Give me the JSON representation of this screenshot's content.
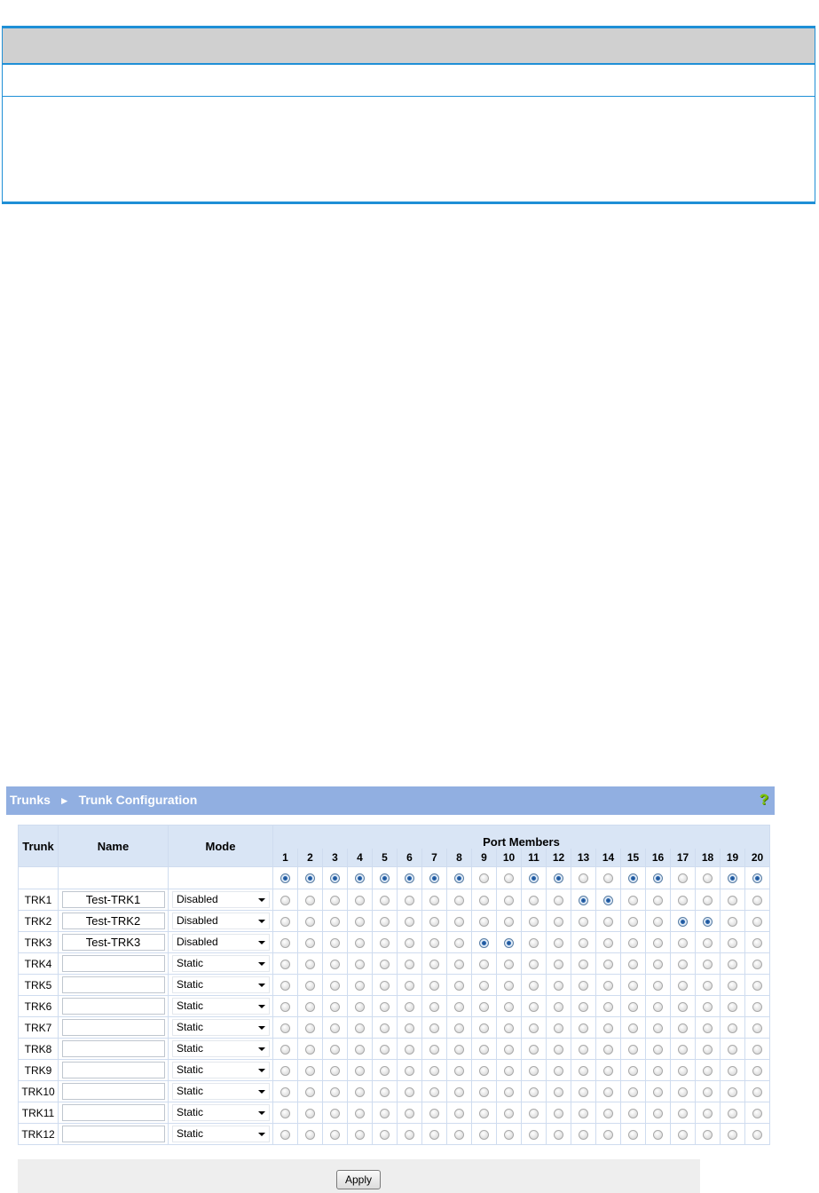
{
  "breadcrumb": {
    "section": "Trunks",
    "separator": "►",
    "page": "Trunk Configuration"
  },
  "help_icon": {
    "name": "help-icon",
    "glyph": "?"
  },
  "headers": {
    "trunk": "Trunk",
    "name": "Name",
    "mode": "Mode",
    "port_members": "Port Members"
  },
  "ports": [
    "1",
    "2",
    "3",
    "4",
    "5",
    "6",
    "7",
    "8",
    "9",
    "10",
    "11",
    "12",
    "13",
    "14",
    "15",
    "16",
    "17",
    "18",
    "19",
    "20"
  ],
  "rows": [
    {
      "trunk": "",
      "name": null,
      "mode": null,
      "selected_ports": [
        1,
        2,
        3,
        4,
        5,
        6,
        7,
        8,
        11,
        12,
        15,
        16,
        19,
        20
      ]
    },
    {
      "trunk": "TRK1",
      "name": "Test-TRK1",
      "mode": "Disabled",
      "selected_ports": [
        13,
        14
      ]
    },
    {
      "trunk": "TRK2",
      "name": "Test-TRK2",
      "mode": "Disabled",
      "selected_ports": [
        17,
        18
      ]
    },
    {
      "trunk": "TRK3",
      "name": "Test-TRK3",
      "mode": "Disabled",
      "selected_ports": [
        9,
        10
      ]
    },
    {
      "trunk": "TRK4",
      "name": "",
      "mode": "Static",
      "selected_ports": []
    },
    {
      "trunk": "TRK5",
      "name": "",
      "mode": "Static",
      "selected_ports": []
    },
    {
      "trunk": "TRK6",
      "name": "",
      "mode": "Static",
      "selected_ports": []
    },
    {
      "trunk": "TRK7",
      "name": "",
      "mode": "Static",
      "selected_ports": []
    },
    {
      "trunk": "TRK8",
      "name": "",
      "mode": "Static",
      "selected_ports": []
    },
    {
      "trunk": "TRK9",
      "name": "",
      "mode": "Static",
      "selected_ports": []
    },
    {
      "trunk": "TRK10",
      "name": "",
      "mode": "Static",
      "selected_ports": []
    },
    {
      "trunk": "TRK11",
      "name": "",
      "mode": "Static",
      "selected_ports": []
    },
    {
      "trunk": "TRK12",
      "name": "",
      "mode": "Static",
      "selected_ports": []
    }
  ],
  "apply_label": "Apply",
  "colors": {
    "title_bar": "#91afe1",
    "header_bg": "#d9e5f5",
    "top_border": "#1f8fd6",
    "radio_selected": "#1a4a8a"
  }
}
